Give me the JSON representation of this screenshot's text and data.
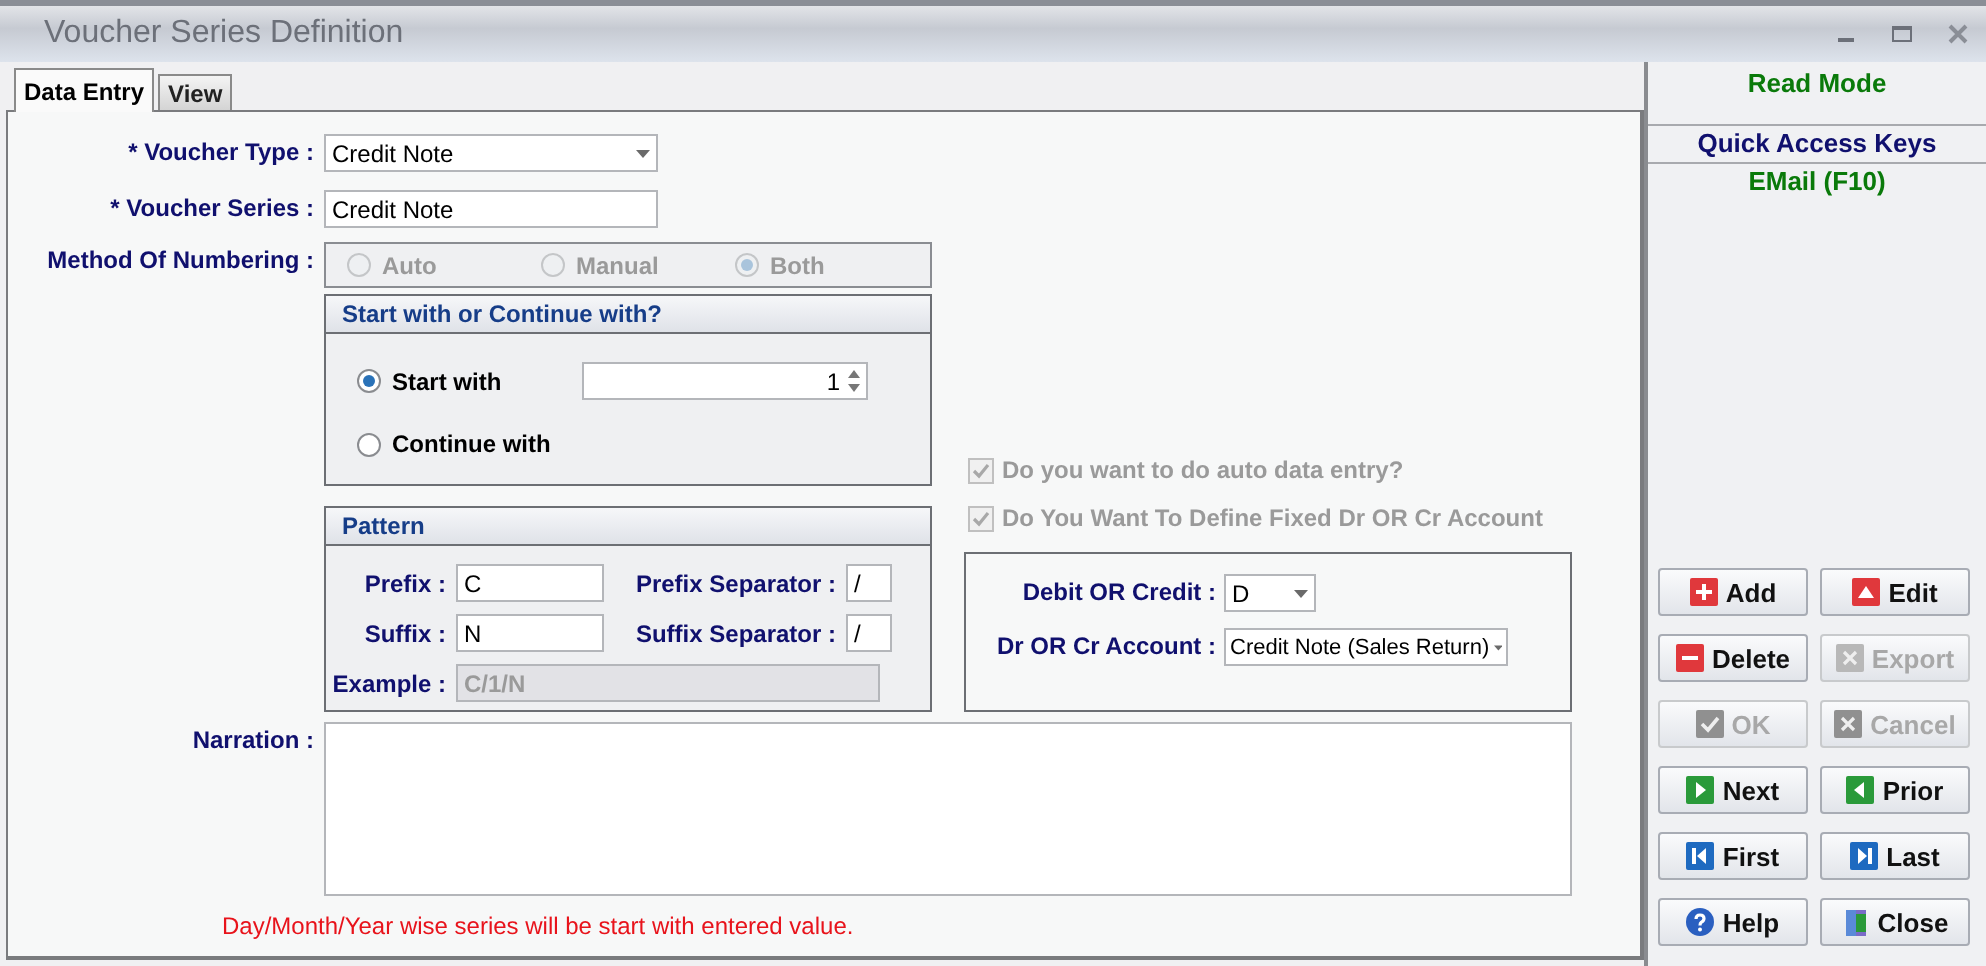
{
  "window": {
    "title": "Voucher Series Definition"
  },
  "tabs": [
    {
      "label": "Data Entry",
      "selected": true
    },
    {
      "label": "View",
      "selected": false
    }
  ],
  "form": {
    "voucher_type": {
      "label": "* Voucher Type :",
      "value": "Credit Note"
    },
    "voucher_series": {
      "label": "* Voucher Series :",
      "value": "Credit Note"
    },
    "method_of_numbering": {
      "label": "Method Of Numbering :",
      "disabled": true,
      "options": [
        {
          "label": "Auto",
          "selected": false
        },
        {
          "label": "Manual",
          "selected": false
        },
        {
          "label": "Both",
          "selected": true
        }
      ]
    },
    "start_group": {
      "title": "Start with or Continue with?",
      "start_value": "1",
      "options": [
        {
          "label": "Start with",
          "selected": true
        },
        {
          "label": "Continue with",
          "selected": false
        }
      ]
    },
    "pattern": {
      "title": "Pattern",
      "fields": [
        {
          "label": "Prefix :",
          "value": "C"
        },
        {
          "label": "Prefix Separator :",
          "value": "/"
        },
        {
          "label": "Suffix :",
          "value": "N"
        },
        {
          "label": "Suffix Separator :",
          "value": "/"
        }
      ],
      "example": {
        "label": "Example :",
        "value": "C/1/N"
      }
    },
    "checkboxes": [
      {
        "label": "Do you want to do auto data entry?",
        "checked": true,
        "disabled": true
      },
      {
        "label": "Do You Want To Define Fixed Dr OR Cr Account",
        "checked": true,
        "disabled": true
      }
    ],
    "account": {
      "debit_or_credit": {
        "label": "Debit OR Credit :",
        "value": "D"
      },
      "dr_or_cr_account": {
        "label": "Dr OR Cr Account :",
        "value": "Credit Note (Sales Return)"
      }
    },
    "narration": {
      "label": "Narration :"
    },
    "note": "Day/Month/Year wise series will be start with entered value."
  },
  "side_panel": {
    "mode": "Read Mode",
    "quick_access_title": "Quick Access Keys",
    "quick_access_keys": [
      "EMail (F10)"
    ],
    "buttons": [
      {
        "label": "Add",
        "kind": "add",
        "disabled": false
      },
      {
        "label": "Edit",
        "kind": "edit",
        "disabled": false
      },
      {
        "label": "Delete",
        "kind": "delete",
        "disabled": false
      },
      {
        "label": "Export",
        "kind": "export",
        "disabled": true
      },
      {
        "label": "OK",
        "kind": "ok",
        "disabled": true
      },
      {
        "label": "Cancel",
        "kind": "cancel",
        "disabled": true
      },
      {
        "label": "Next",
        "kind": "next",
        "disabled": false
      },
      {
        "label": "Prior",
        "kind": "prior",
        "disabled": false
      },
      {
        "label": "First",
        "kind": "first",
        "disabled": false
      },
      {
        "label": "Last",
        "kind": "last",
        "disabled": false
      },
      {
        "label": "Help",
        "kind": "help",
        "disabled": false
      },
      {
        "label": "Close",
        "kind": "close",
        "disabled": false
      }
    ]
  }
}
